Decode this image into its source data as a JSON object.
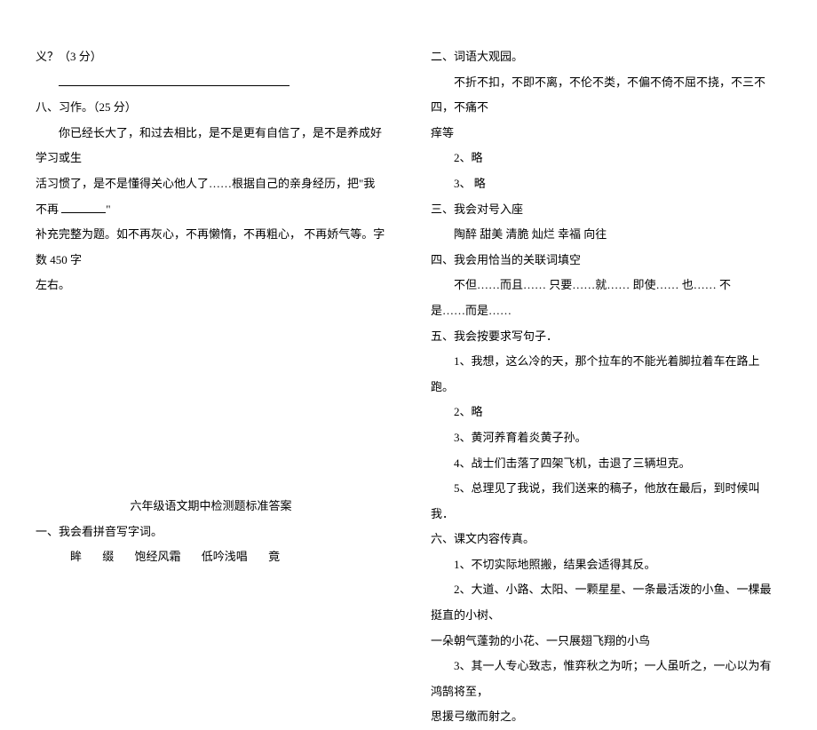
{
  "left": {
    "q_end": "义？（3 分）",
    "section8": "八、习作。（25 分）",
    "writing_line1": "你已经长大了，和过去相比，是不是更有自信了，是不是养成好学习或生",
    "writing_line2_a": "活习惯了，是不是懂得关心他人了……根据自己的亲身经历，把\"我不再 ",
    "writing_line2_b": "\" ",
    "writing_line3": "补充完整为题。如不再灰心，不再懒惰，不再粗心，  不再娇气等。字数 450 字",
    "writing_line4": "左右。",
    "answer_title": "六年级语文期中检测题标准答案",
    "ans1_heading": "一、我会看拼音写字词。",
    "pinyin": {
      "a": "眸",
      "b": "缀",
      "c": "饱经风霜",
      "d": "低吟浅唱",
      "e": "竟"
    }
  },
  "right": {
    "ans2_heading": "二、词语大观园。",
    "ans2_line1": "不折不扣，不即不离，不伦不类，不偏不倚不屈不挠，不三不四，不痛不",
    "ans2_line2": "痒等",
    "ans2_2": "2、略",
    "ans2_3": "3、 略",
    "ans3_heading": "三、我会对号入座",
    "ans3_line": "陶醉  甜美  清脆  灿烂  幸福  向往",
    "ans4_heading": "四、我会用恰当的关联词填空",
    "ans4_line1": "不但……而且……        只要……就……      即使……   也……     不",
    "ans4_line2": "是……而是……",
    "ans5_heading": "五、我会按要求写句子．",
    "ans5_1": "1、我想，这么冷的天，那个拉车的不能光着脚拉着车在路上跑。",
    "ans5_2": "2、略",
    "ans5_3": "3、黄河养育着炎黄子孙。",
    "ans5_4": "4、战士们击落了四架飞机，击退了三辆坦克。",
    "ans5_5": "5、总理见了我说，我们送来的稿子，他放在最后，到时候叫我．",
    "ans6_heading": "六、课文内容传真。",
    "ans6_1": "1、不切实际地照搬，结果会适得其反。",
    "ans6_2a": "2、大道、小路、太阳、一颗星星、一条最活泼的小鱼、一棵最挺直的小树、",
    "ans6_2b": "一朵朝气蓬勃的小花、一只展翅飞翔的小鸟",
    "ans6_3a": "3、其一人专心致志，惟弈秋之为听；一人虽听之，一心以为有鸿鹄将至，",
    "ans6_3b": "思援弓缴而射之。"
  }
}
